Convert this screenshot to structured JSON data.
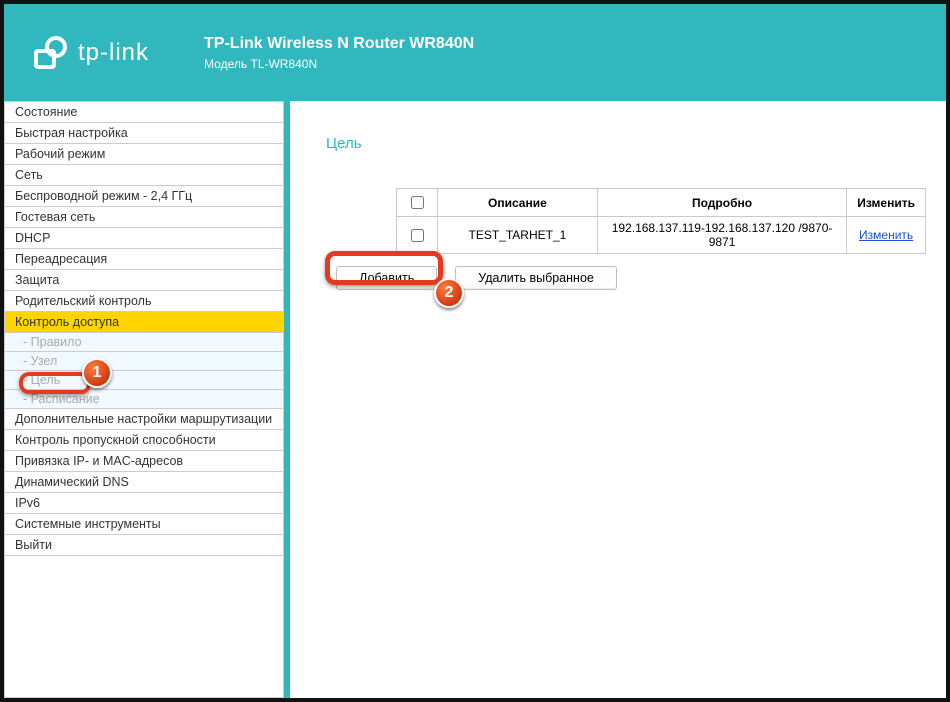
{
  "header": {
    "brand": "tp-link",
    "title": "TP-Link Wireless N Router WR840N",
    "subtitle": "Модель TL-WR840N"
  },
  "sidebar": {
    "items": [
      {
        "label": "Состояние",
        "type": "item"
      },
      {
        "label": "Быстрая настройка",
        "type": "item"
      },
      {
        "label": "Рабочий режим",
        "type": "item"
      },
      {
        "label": "Сеть",
        "type": "item"
      },
      {
        "label": "Беспроводной режим - 2,4 ГГц",
        "type": "item"
      },
      {
        "label": "Гостевая сеть",
        "type": "item"
      },
      {
        "label": "DHCP",
        "type": "item"
      },
      {
        "label": "Переадресация",
        "type": "item"
      },
      {
        "label": "Защита",
        "type": "item"
      },
      {
        "label": "Родительский контроль",
        "type": "item"
      },
      {
        "label": "Контроль доступа",
        "type": "item",
        "active": true
      },
      {
        "label": "- Правило",
        "type": "sub"
      },
      {
        "label": "- Узел",
        "type": "sub"
      },
      {
        "label": "- Цель",
        "type": "sub"
      },
      {
        "label": "- Расписание",
        "type": "sub"
      },
      {
        "label": "Дополнительные настройки маршрутизации",
        "type": "item"
      },
      {
        "label": "Контроль пропускной способности",
        "type": "item"
      },
      {
        "label": "Привязка IP- и MAC-адресов",
        "type": "item"
      },
      {
        "label": "Динамический DNS",
        "type": "item"
      },
      {
        "label": "IPv6",
        "type": "item"
      },
      {
        "label": "Системные инструменты",
        "type": "item"
      },
      {
        "label": "Выйти",
        "type": "item"
      }
    ]
  },
  "content": {
    "page_title": "Цель",
    "table": {
      "headers": {
        "desc": "Описание",
        "details": "Подробно",
        "change": "Изменить"
      },
      "rows": [
        {
          "desc": "TEST_TARHET_1",
          "details": "192.168.137.119-192.168.137.120 /9870-9871",
          "change": "Изменить"
        }
      ]
    },
    "buttons": {
      "add": "Добавить",
      "delete_selected": "Удалить выбранное"
    }
  },
  "markers": {
    "one": "1",
    "two": "2"
  }
}
